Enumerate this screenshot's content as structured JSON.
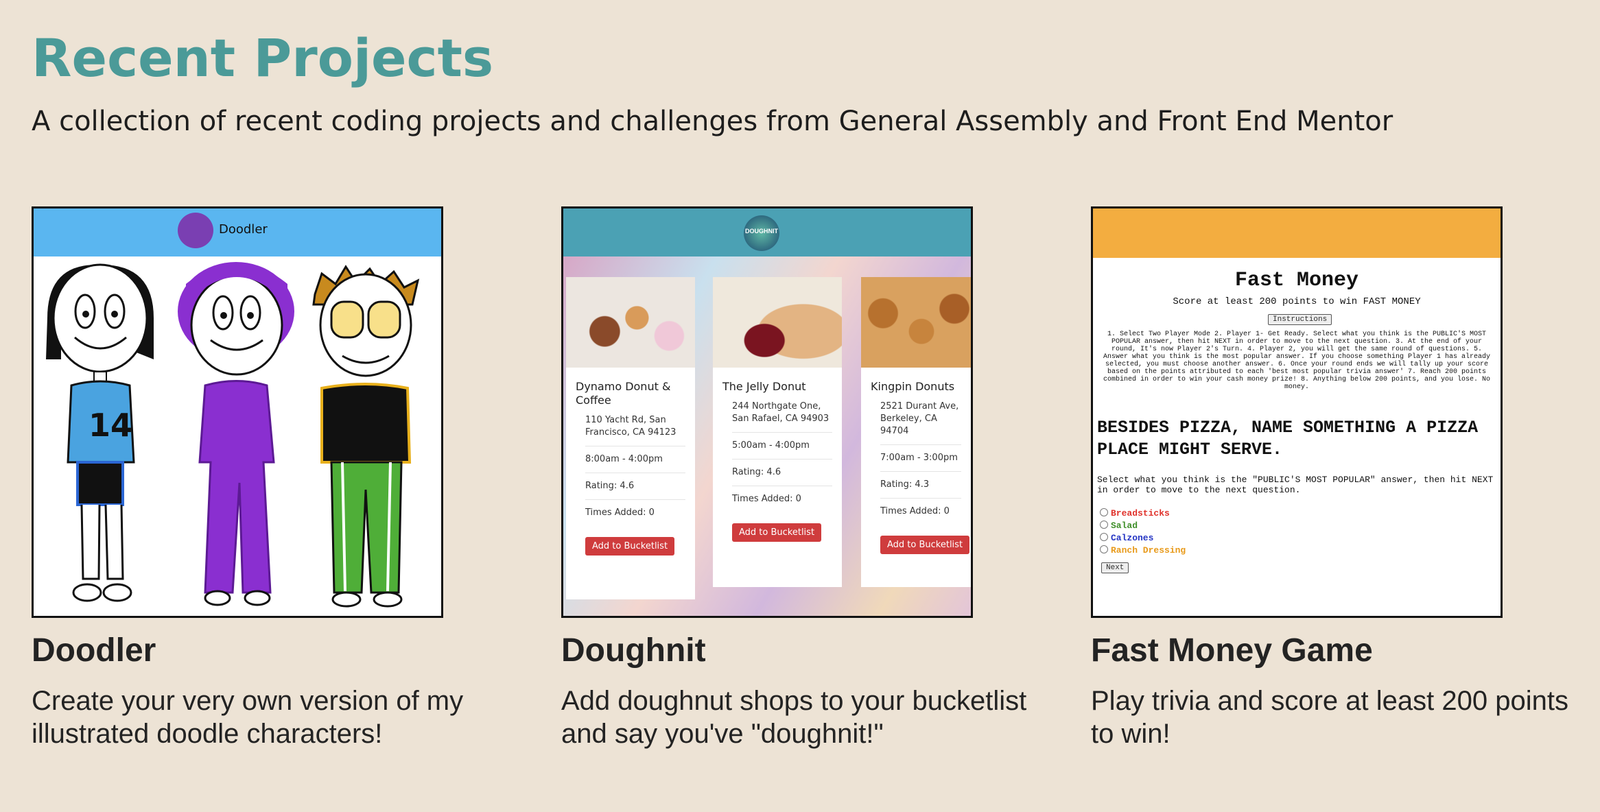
{
  "header": {
    "title": "Recent Projects",
    "subtitle": "A collection of recent coding projects and challenges from General Assembly and Front End Mentor"
  },
  "projects": [
    {
      "title": "Doodler",
      "description": "Create your very own version of my illustrated doodle characters!",
      "thumb": {
        "app_name": "Doodler",
        "jersey_number": "14"
      }
    },
    {
      "title": "Doughnit",
      "description": "Add doughnut shops to your bucketlist and say you've \"doughnit!\"",
      "thumb": {
        "logo_text": "DOUGHNIT",
        "shops": [
          {
            "name": "Dynamo Donut & Coffee",
            "address": "110 Yacht Rd, San Francisco, CA 94123",
            "hours": "8:00am - 4:00pm",
            "rating": "Rating: 4.6",
            "times_added": "Times Added: 0",
            "button": "Add to Bucketlist"
          },
          {
            "name": "The Jelly Donut",
            "address": "244 Northgate One, San Rafael, CA 94903",
            "hours": "5:00am - 4:00pm",
            "rating": "Rating: 4.6",
            "times_added": "Times Added: 0",
            "button": "Add to Bucketlist"
          },
          {
            "name": "Kingpin Donuts",
            "address": "2521 Durant Ave, Berkeley, CA 94704",
            "hours": "7:00am - 3:00pm",
            "rating": "Rating: 4.3",
            "times_added": "Times Added: 0",
            "button": "Add to Bucketlist"
          }
        ]
      }
    },
    {
      "title": "Fast Money Game",
      "description": "Play trivia and score at least 200 points to win!",
      "thumb": {
        "game_title": "Fast Money",
        "subtitle": "Score at least 200 points to win FAST MONEY",
        "instructions_button": "Instructions",
        "instructions": "1. Select Two Player Mode 2. Player 1- Get Ready. Select what you think is the PUBLIC'S MOST POPULAR answer, then hit NEXT in order to move to the next question. 3. At the end of your round, It's now Player 2's Turn. 4. Player 2, you will get the same round of questions. 5. Answer what you think is the most popular answer. If you choose something Player 1 has already selected, you must choose another answer. 6. Once your round ends we will tally up your score based on the points attributed to each 'best most popular trivia answer' 7. Reach 200 points combined in order to win your cash money prize! 8. Anything below 200 points, and you lose. No money.",
        "question": "BESIDES PIZZA, NAME SOMETHING A PIZZA PLACE MIGHT SERVE.",
        "prompt": "Select what you think is the \"PUBLIC'S MOST POPULAR\" answer, then hit NEXT in order to move to the next question.",
        "options": [
          {
            "label": "Breadsticks",
            "color": "#e0322b"
          },
          {
            "label": "Salad",
            "color": "#3f8f2a"
          },
          {
            "label": "Calzones",
            "color": "#2636c4"
          },
          {
            "label": "Ranch Dressing",
            "color": "#e89a1a"
          }
        ],
        "next_button": "Next"
      }
    }
  ],
  "colors": {
    "background": "#ede3d5",
    "title": "#4b9a98",
    "doodler_header": "#5ab6f0",
    "doughnit_header": "#4ba1b4",
    "fastmoney_header": "#f3ad40",
    "button_red": "#cf3c3d"
  }
}
